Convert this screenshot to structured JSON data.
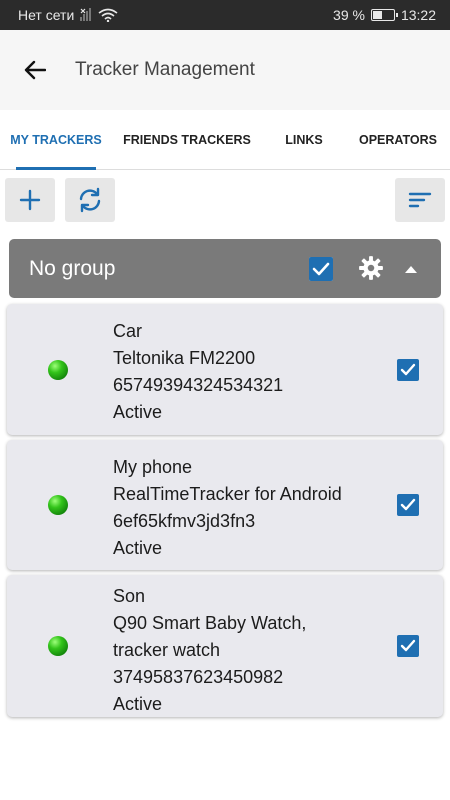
{
  "status_bar": {
    "network": "Нет сети",
    "battery": "39 %",
    "battery_level": 0.39,
    "time": "13:22"
  },
  "header": {
    "title": "Tracker Management"
  },
  "tabs": [
    {
      "label": "MY TRACKERS",
      "active": true
    },
    {
      "label": "FRIENDS TRACKERS",
      "active": false
    },
    {
      "label": "LINKS",
      "active": false
    },
    {
      "label": "OPERATORS",
      "active": false
    }
  ],
  "toolbar": {
    "add_icon": "plus-icon",
    "refresh_icon": "refresh-icon",
    "sort_icon": "sort-icon"
  },
  "group": {
    "title": "No group",
    "checked": true
  },
  "trackers": [
    {
      "name": "Car",
      "model": "Teltonika FM2200",
      "id": "65749394324534321",
      "status": "Active",
      "checked": true
    },
    {
      "name": "My phone",
      "model": "RealTimeTracker for Android",
      "id": "6ef65kfmv3jd3fn3",
      "status": "Active",
      "checked": true
    },
    {
      "name": "Son",
      "model": "Q90 Smart Baby Watch,",
      "model_line2": "tracker watch",
      "id": "37495837623450982",
      "status": "Active",
      "checked": true
    }
  ],
  "colors": {
    "accent": "#1f6fb2",
    "status_dot": "#33c41a",
    "group_header": "#7a7a7a"
  }
}
